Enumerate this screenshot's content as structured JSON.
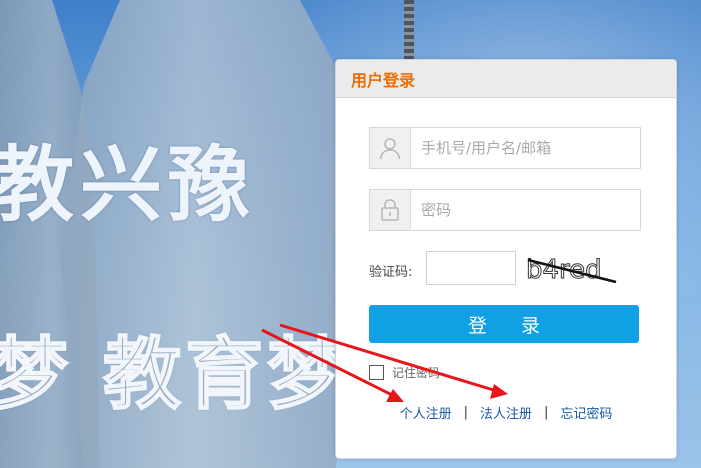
{
  "background": {
    "slogan_line1": "教兴豫",
    "slogan_line2": "梦 教育梦"
  },
  "login": {
    "title": "用户登录",
    "username_placeholder": "手机号/用户名/邮箱",
    "password_placeholder": "密码",
    "captcha_label": "验证码:",
    "captcha_value": "",
    "captcha_text": "b4red",
    "submit_label": "登 录",
    "remember_label": "记住密码",
    "links": {
      "personal_register": "个人注册",
      "corporate_register": "法人注册",
      "forgot_password": "忘记密码",
      "separator": "|"
    }
  },
  "colors": {
    "title": "#ef6c00",
    "button": "#10a1e4",
    "link": "#1a57a5",
    "annotation_arrows": "#e8161b"
  },
  "icons": {
    "username": "user-icon",
    "password": "lock-icon"
  }
}
